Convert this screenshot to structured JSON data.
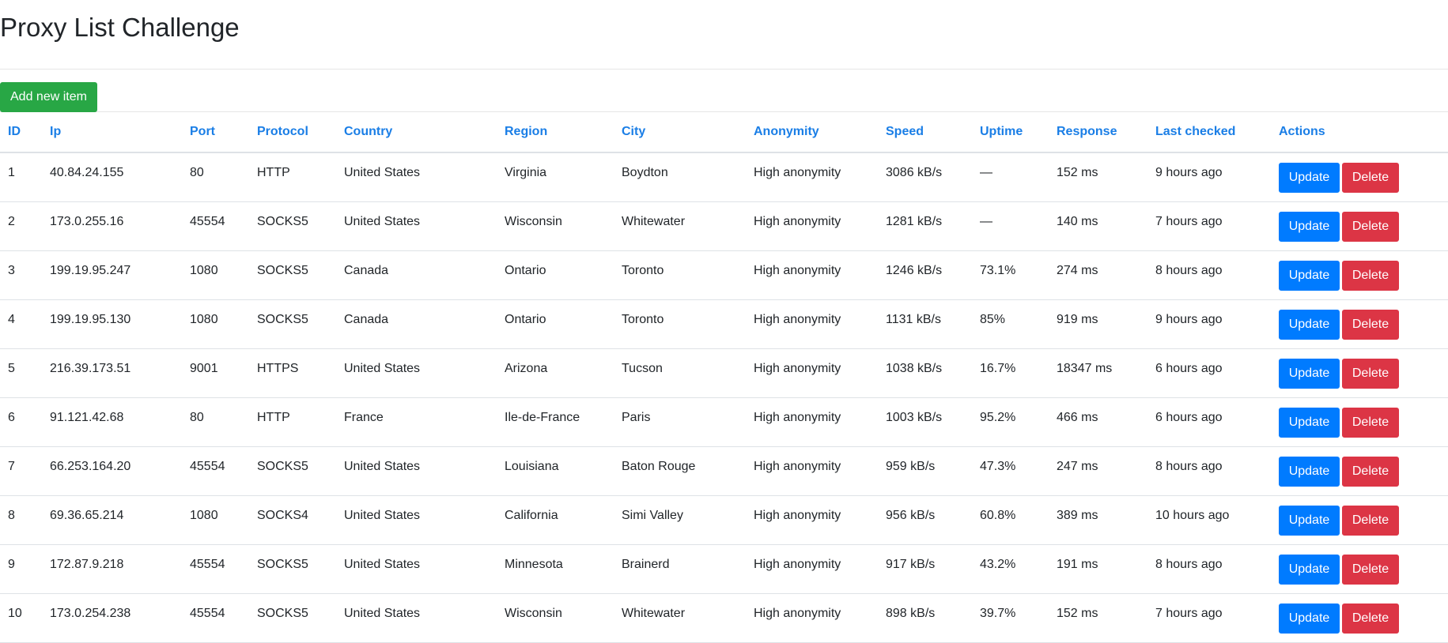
{
  "page": {
    "title": "Proxy List Challenge"
  },
  "toolbar": {
    "add_label": "Add new item"
  },
  "table": {
    "columns": [
      "ID",
      "Ip",
      "Port",
      "Protocol",
      "Country",
      "Region",
      "City",
      "Anonymity",
      "Speed",
      "Uptime",
      "Response",
      "Last checked",
      "Actions"
    ],
    "update_label": "Update",
    "delete_label": "Delete",
    "rows": [
      [
        "1",
        "40.84.24.155",
        "80",
        "HTTP",
        "United States",
        "Virginia",
        "Boydton",
        "High anonymity",
        "3086 kB/s",
        "—",
        "152 ms",
        "9 hours ago"
      ],
      [
        "2",
        "173.0.255.16",
        "45554",
        "SOCKS5",
        "United States",
        "Wisconsin",
        "Whitewater",
        "High anonymity",
        "1281 kB/s",
        "—",
        "140 ms",
        "7 hours ago"
      ],
      [
        "3",
        "199.19.95.247",
        "1080",
        "SOCKS5",
        "Canada",
        "Ontario",
        "Toronto",
        "High anonymity",
        "1246 kB/s",
        "73.1%",
        "274 ms",
        "8 hours ago"
      ],
      [
        "4",
        "199.19.95.130",
        "1080",
        "SOCKS5",
        "Canada",
        "Ontario",
        "Toronto",
        "High anonymity",
        "1131 kB/s",
        "85%",
        "919 ms",
        "9 hours ago"
      ],
      [
        "5",
        "216.39.173.51",
        "9001",
        "HTTPS",
        "United States",
        "Arizona",
        "Tucson",
        "High anonymity",
        "1038 kB/s",
        "16.7%",
        "18347 ms",
        "6 hours ago"
      ],
      [
        "6",
        "91.121.42.68",
        "80",
        "HTTP",
        "France",
        "Ile-de-France",
        "Paris",
        "High anonymity",
        "1003 kB/s",
        "95.2%",
        "466 ms",
        "6 hours ago"
      ],
      [
        "7",
        "66.253.164.20",
        "45554",
        "SOCKS5",
        "United States",
        "Louisiana",
        "Baton Rouge",
        "High anonymity",
        "959 kB/s",
        "47.3%",
        "247 ms",
        "8 hours ago"
      ],
      [
        "8",
        "69.36.65.214",
        "1080",
        "SOCKS4",
        "United States",
        "California",
        "Simi Valley",
        "High anonymity",
        "956 kB/s",
        "60.8%",
        "389 ms",
        "10 hours ago"
      ],
      [
        "9",
        "172.87.9.218",
        "45554",
        "SOCKS5",
        "United States",
        "Minnesota",
        "Brainerd",
        "High anonymity",
        "917 kB/s",
        "43.2%",
        "191 ms",
        "8 hours ago"
      ],
      [
        "10",
        "173.0.254.238",
        "45554",
        "SOCKS5",
        "United States",
        "Wisconsin",
        "Whitewater",
        "High anonymity",
        "898 kB/s",
        "39.7%",
        "152 ms",
        "7 hours ago"
      ]
    ]
  },
  "colors": {
    "header_link": "#1a7ee6",
    "add_button": "#28a745",
    "update_button": "#007bff",
    "delete_button": "#dc3545"
  }
}
